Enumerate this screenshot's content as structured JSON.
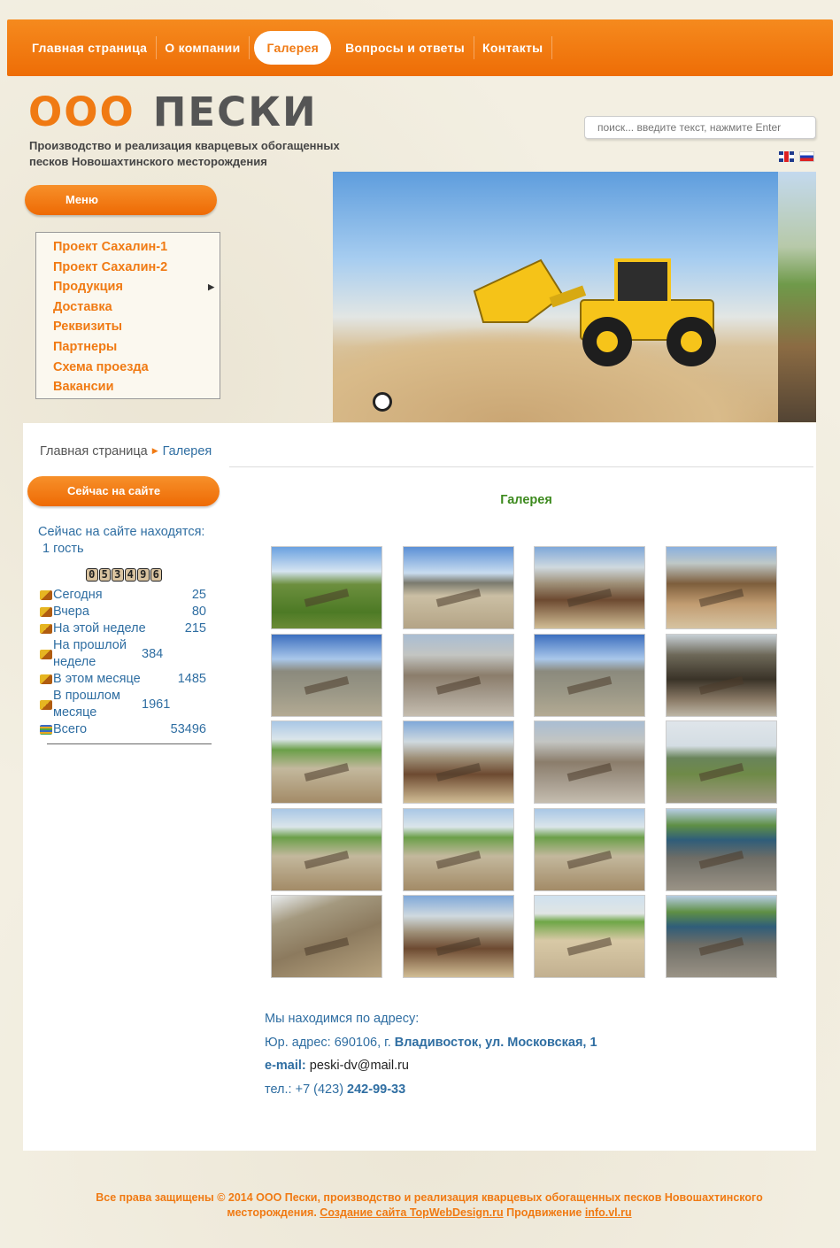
{
  "nav": {
    "items": [
      {
        "label": "Главная страница"
      },
      {
        "label": "О компании"
      },
      {
        "label": "Галерея",
        "active": true
      },
      {
        "label": "Вопросы и ответы"
      },
      {
        "label": "Контакты"
      }
    ]
  },
  "logo": {
    "prefix": "ООО",
    "name": "ПЕСКИ"
  },
  "tagline": "Производство и реализация кварцевых обогащенных песков Новошахтинского месторождения",
  "search": {
    "placeholder": "поиск... введите текст, нажмите Enter"
  },
  "languages": [
    "en-flag-icon",
    "ru-flag-icon"
  ],
  "menu": {
    "title": "Меню",
    "items": [
      {
        "label": "Проект Сахалин-1"
      },
      {
        "label": "Проект Сахалин-2"
      },
      {
        "label": "Продукция",
        "has_submenu": true
      },
      {
        "label": "Доставка"
      },
      {
        "label": "Реквизиты"
      },
      {
        "label": "Партнеры"
      },
      {
        "label": "Схема проезда"
      },
      {
        "label": "Вакансии"
      }
    ]
  },
  "breadcrumb": {
    "home": "Главная страница",
    "current": "Галерея"
  },
  "online": {
    "title": "Сейчас на сайте",
    "text": "Сейчас на сайте находятся:",
    "guests": "1 гость",
    "counter": "053496",
    "stats": [
      {
        "label": "Сегодня",
        "value": "25"
      },
      {
        "label": "Вчера",
        "value": "80"
      },
      {
        "label": "На этой неделе",
        "value": "215"
      },
      {
        "label": "На прошлой неделе",
        "value": "384"
      },
      {
        "label": "В этом месяце",
        "value": "1485"
      },
      {
        "label": "В прошлом месяце",
        "value": "1961"
      },
      {
        "label": "Всего",
        "value": "53496"
      }
    ]
  },
  "gallery": {
    "title": "Галерея",
    "thumbs": [
      "t-green",
      "t-road",
      "t-machine",
      "t-pipe",
      "t-quarry",
      "t-grey",
      "t-quarry",
      "t-dark",
      "t-lake",
      "t-machine",
      "t-grey",
      "t-field",
      "t-lake",
      "t-lake",
      "t-lake",
      "t-pool",
      "t-slope",
      "t-machine",
      "t-yellow",
      "t-pool"
    ]
  },
  "address": {
    "intro": "Мы находимся по адресу:",
    "legal_prefix": "Юр. адрес: 690106, г. ",
    "legal_bold": "Владивосток, ул. Московская, 1",
    "email_label": "e-mail:",
    "email": " peski-dv@mail.ru",
    "phone_prefix": "тел.: +7 (423) ",
    "phone_bold": "242-99-33"
  },
  "footer": {
    "text": "Все права защищены © 2014 ООО Пески, производство и реализация кварцевых обогащенных песков Новошахтинского месторождения. ",
    "link1": "Создание сайта TopWebDesign.ru",
    "middle": " Продвижение ",
    "link2": "info.vl.ru"
  },
  "colors": {
    "accent": "#f07a13",
    "link": "#2f6ea2",
    "gallery_title": "#3d8a1e"
  }
}
